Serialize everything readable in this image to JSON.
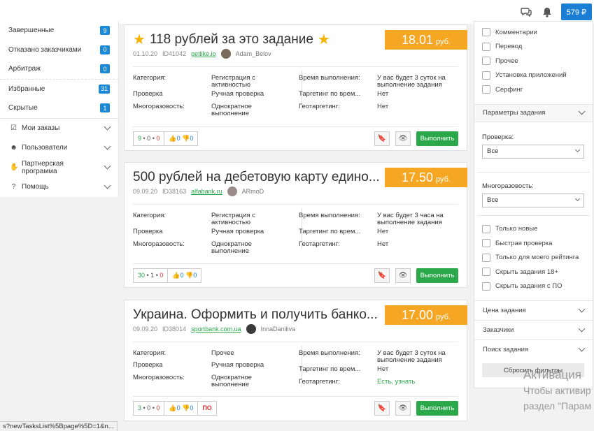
{
  "header": {
    "balance": "579 ₽",
    "icons": [
      "chat-icon",
      "bell-icon",
      "ruble-icon"
    ]
  },
  "sidebar": {
    "stats": [
      {
        "label": "Завершенные",
        "count": "9"
      },
      {
        "label": "Отказано заказчиками",
        "count": "0"
      },
      {
        "label": "Арбитраж",
        "count": "0"
      },
      {
        "label": "Избранные",
        "count": "31"
      },
      {
        "label": "Скрытые",
        "count": "1"
      }
    ],
    "menu": [
      {
        "label": "Мои заказы",
        "icon": "checkbox-icon"
      },
      {
        "label": "Пользователи",
        "icon": "users-icon"
      },
      {
        "label": "Партнерская программа",
        "icon": "handshake-icon"
      },
      {
        "label": "Помощь",
        "icon": "question-icon"
      }
    ]
  },
  "tasks": [
    {
      "title": "118 рублей за это задание",
      "price": "18.01",
      "currency": "руб.",
      "date": "01.10.20",
      "id": "ID41042",
      "site": "getlike.io",
      "user": "Adam_Belov",
      "props": {
        "category_label": "Категория:",
        "category": "Регистрация с активностью",
        "check_label": "Проверка",
        "check": "Ручная проверка",
        "multi_label": "Многоразовость:",
        "multi": "Однократное выполнение",
        "time_label": "Время выполнения:",
        "time": "У вас будет 3 суток на выполнение задания",
        "target_label": "Таргетинг по врем...",
        "target": "Нет",
        "geo_label": "Геотаргетинг:",
        "geo": "Нет"
      },
      "votes": {
        "a": "9",
        "b": "0",
        "c": "0",
        "likes": "0",
        "dislikes": "0"
      },
      "run_label": "Выполнить"
    },
    {
      "title": "500 рублей на дебетовую карту едино...",
      "price": "17.50",
      "currency": "руб.",
      "date": "09.09.20",
      "id": "ID38163",
      "site": "alfabank.ru",
      "user": "ARmoD",
      "props": {
        "category_label": "Категория:",
        "category": "Регистрация с активностью",
        "check_label": "Проверка",
        "check": "Ручная проверка",
        "multi_label": "Многоразовость:",
        "multi": "Однократное выполнение",
        "time_label": "Время выполнения:",
        "time": "У вас будет 3 часа на выполнение задания",
        "target_label": "Таргетинг по врем...",
        "target": "Нет",
        "geo_label": "Геотаргетинг:",
        "geo": "Нет"
      },
      "votes": {
        "a": "30",
        "b": "1",
        "c": "0",
        "likes": "0",
        "dislikes": "0"
      },
      "run_label": "Выполнить"
    },
    {
      "title": "Украина. Оформить и получить банко...",
      "price": "17.00",
      "currency": "руб.",
      "date": "09.09.20",
      "id": "ID38014",
      "site": "sportbank.com.ua",
      "user": "InnaDaniliva",
      "props": {
        "category_label": "Категория:",
        "category": "Прочее",
        "check_label": "Проверка",
        "check": "Ручная проверка",
        "multi_label": "Многоразовость:",
        "multi": "Однократное выполнение",
        "time_label": "Время выполнения:",
        "time": "У вас будет 3 суток на выполнение задания",
        "target_label": "Таргетинг по врем...",
        "target": "Нет",
        "geo_label": "Геотаргетинг:",
        "geo": "Есть, узнать"
      },
      "votes": {
        "a": "3",
        "b": "0",
        "c": "0",
        "likes": "0",
        "dislikes": "0",
        "badge": "ПО"
      },
      "run_label": "Выполнить"
    }
  ],
  "filters": {
    "categories": [
      "Комментарии",
      "Перевод",
      "Прочее",
      "Установка приложений",
      "Серфинг"
    ],
    "params_title": "Параметры задания",
    "check_label": "Проверка:",
    "check_value": "Все",
    "multi_label": "Многоразовость:",
    "multi_value": "Все",
    "options": [
      "Только новые",
      "Быстрая проверка",
      "Только для моего рейтинга",
      "Скрыть задания 18+",
      "Скрыть задания с ПО"
    ],
    "sections": [
      "Цена задания",
      "Заказчики",
      "Поиск задания"
    ],
    "reset_label": "Сбросить фильтры"
  },
  "status_url": "s?newTasksList%5Bpage%5D=1&n...",
  "watermark": {
    "line1": "Активация",
    "line2": "Чтобы активир",
    "line3": "раздел \"Парам"
  }
}
